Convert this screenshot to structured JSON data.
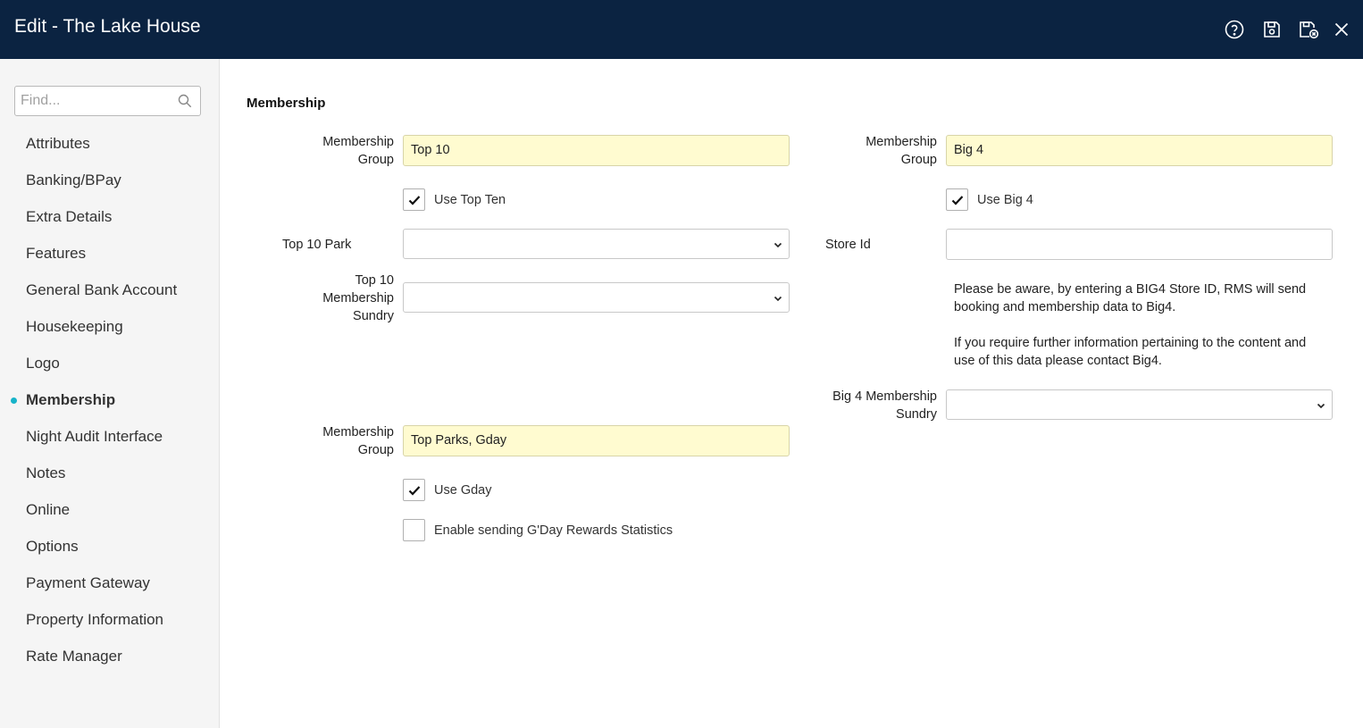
{
  "window": {
    "title": "Edit - The Lake House",
    "icons": [
      "help-icon",
      "save-icon",
      "save-close-icon",
      "close-icon"
    ]
  },
  "sidebar": {
    "search": {
      "placeholder": "Find...",
      "value": ""
    },
    "items": [
      {
        "label": "Attributes",
        "active": false
      },
      {
        "label": "Banking/BPay",
        "active": false
      },
      {
        "label": "Extra Details",
        "active": false
      },
      {
        "label": "Features",
        "active": false
      },
      {
        "label": "General Bank Account",
        "active": false
      },
      {
        "label": "Housekeeping",
        "active": false
      },
      {
        "label": "Logo",
        "active": false
      },
      {
        "label": "Membership",
        "active": true
      },
      {
        "label": "Night Audit Interface",
        "active": false
      },
      {
        "label": "Notes",
        "active": false
      },
      {
        "label": "Online",
        "active": false
      },
      {
        "label": "Options",
        "active": false
      },
      {
        "label": "Payment Gateway",
        "active": false
      },
      {
        "label": "Property Information",
        "active": false
      },
      {
        "label": "Rate Manager",
        "active": false
      }
    ]
  },
  "main": {
    "section_title": "Membership",
    "left": {
      "top10": {
        "group_label_1": "Membership",
        "group_label_2": "Group",
        "group_value": "Top 10",
        "use_label": "Use Top Ten",
        "use_checked": true,
        "park_label": "Top 10 Park",
        "park_value": "",
        "sundry_label_1": "Top 10",
        "sundry_label_2": "Membership",
        "sundry_label_3": "Sundry",
        "sundry_value": ""
      },
      "gday": {
        "group_label_1": "Membership",
        "group_label_2": "Group",
        "group_value": "Top Parks, Gday",
        "use_label": "Use Gday",
        "use_checked": true,
        "stats_label": "Enable sending G'Day Rewards Statistics",
        "stats_checked": false
      }
    },
    "right": {
      "big4": {
        "group_label_1": "Membership",
        "group_label_2": "Group",
        "group_value": "Big 4",
        "use_label": "Use Big 4",
        "use_checked": true,
        "store_label": "Store Id",
        "store_value": "",
        "info_1a": "Please be aware, by entering a BIG4 Store ID, RMS will send",
        "info_1b": "booking and membership data to Big4.",
        "info_2a": "If you require further information pertaining to the content and",
        "info_2b": "use of this data please contact Big4.",
        "sundry_label_1": "Big 4 Membership",
        "sundry_label_2": "Sundry",
        "sundry_value": ""
      }
    }
  },
  "colors": {
    "titlebar": "#0b2341",
    "accent_dot": "#17b3c9",
    "highlight_field": "#fffbd0"
  }
}
